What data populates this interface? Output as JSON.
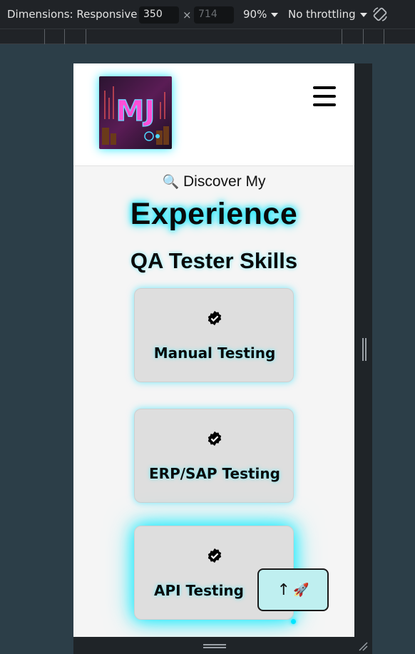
{
  "devtools": {
    "dimensions_label": "Dimensions: Responsive",
    "width_value": "350",
    "times": "×",
    "height_placeholder": "714",
    "zoom": "90%",
    "throttling": "No throttling",
    "icons": [
      "chevron-down-icon",
      "rotate-icon"
    ]
  },
  "site": {
    "logo_text": "MJ",
    "menu_icon": "hamburger-menu-icon",
    "discover_icon": "🔍",
    "discover_text": "Discover My",
    "title": "Experience",
    "section_heading": "QA Tester Skills",
    "skills": [
      {
        "label": "Manual Testing",
        "icon": "check-badge-icon"
      },
      {
        "label": "ERP/SAP Testing",
        "icon": "check-badge-icon"
      },
      {
        "label": "API Testing",
        "icon": "check-badge-icon"
      }
    ],
    "back_to_top": {
      "arrow": "↑",
      "icon": "🚀"
    },
    "colors": {
      "glow": "#00e5ff",
      "card_bg": "#dedede",
      "page_bg": "#f5f5f5",
      "button_bg": "#bfeff0"
    }
  }
}
